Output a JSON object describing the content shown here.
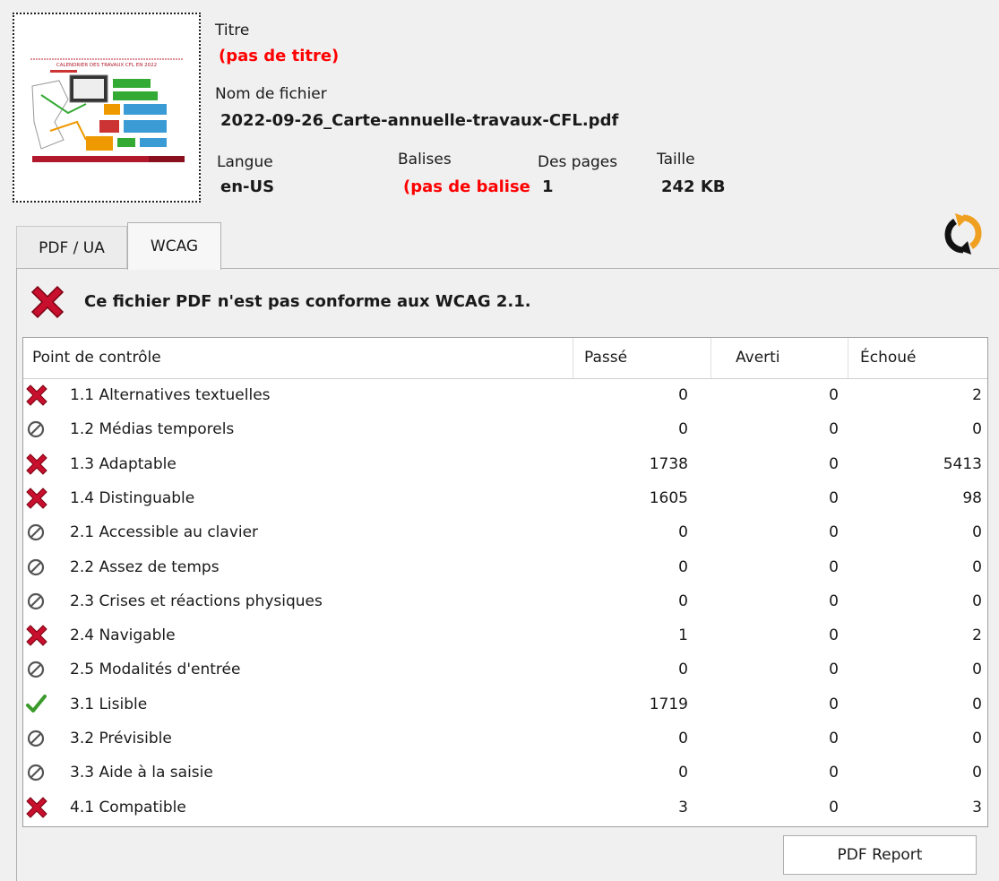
{
  "file": {
    "title_label": "Titre",
    "title_value": "(pas de titre)",
    "filename_label": "Nom de fichier",
    "filename_value": "2022-09-26_Carte-annuelle-travaux-CFL.pdf",
    "language_label": "Langue",
    "language_value": "en-US",
    "tags_label": "Balises",
    "tags_value": "(pas de balises)",
    "pages_label": "Des pages",
    "pages_value": "1",
    "size_label": "Taille",
    "size_value": "242 KB",
    "thumbnail_heading": "CALENDRIER DES TRAVAUX CFL EN 2022"
  },
  "tabs": [
    {
      "label": "PDF / UA",
      "active": false
    },
    {
      "label": "WCAG",
      "active": true
    }
  ],
  "status": {
    "message": "Ce fichier PDF n'est pas conforme aux WCAG 2.1.",
    "icon": "fail-x-icon"
  },
  "table": {
    "columns": [
      "Point de contrôle",
      "Passé",
      "Averti",
      "Échoué"
    ],
    "rows": [
      {
        "status": "fail",
        "name": "1.1 Alternatives textuelles",
        "passed": "0",
        "warned": "0",
        "failed": "2"
      },
      {
        "status": "na",
        "name": "1.2 Médias temporels",
        "passed": "0",
        "warned": "0",
        "failed": "0"
      },
      {
        "status": "fail",
        "name": "1.3 Adaptable",
        "passed": "1738",
        "warned": "0",
        "failed": "5413"
      },
      {
        "status": "fail",
        "name": "1.4 Distinguable",
        "passed": "1605",
        "warned": "0",
        "failed": "98"
      },
      {
        "status": "na",
        "name": "2.1 Accessible au clavier",
        "passed": "0",
        "warned": "0",
        "failed": "0"
      },
      {
        "status": "na",
        "name": "2.2 Assez de temps",
        "passed": "0",
        "warned": "0",
        "failed": "0"
      },
      {
        "status": "na",
        "name": "2.3 Crises et réactions physiques",
        "passed": "0",
        "warned": "0",
        "failed": "0"
      },
      {
        "status": "fail",
        "name": "2.4 Navigable",
        "passed": "1",
        "warned": "0",
        "failed": "2"
      },
      {
        "status": "na",
        "name": "2.5 Modalités d'entrée",
        "passed": "0",
        "warned": "0",
        "failed": "0"
      },
      {
        "status": "pass",
        "name": "3.1 Lisible",
        "passed": "1719",
        "warned": "0",
        "failed": "0"
      },
      {
        "status": "na",
        "name": "3.2 Prévisible",
        "passed": "0",
        "warned": "0",
        "failed": "0"
      },
      {
        "status": "na",
        "name": "3.3 Aide à la saisie",
        "passed": "0",
        "warned": "0",
        "failed": "0"
      },
      {
        "status": "fail",
        "name": "4.1 Compatible",
        "passed": "3",
        "warned": "0",
        "failed": "3"
      }
    ]
  },
  "buttons": {
    "report_label": "PDF Report"
  },
  "colors": {
    "error_red": "#ff0000",
    "fail_icon": "#c8102e",
    "pass_icon": "#3a9a2a",
    "refresh_orange": "#f0a020"
  }
}
